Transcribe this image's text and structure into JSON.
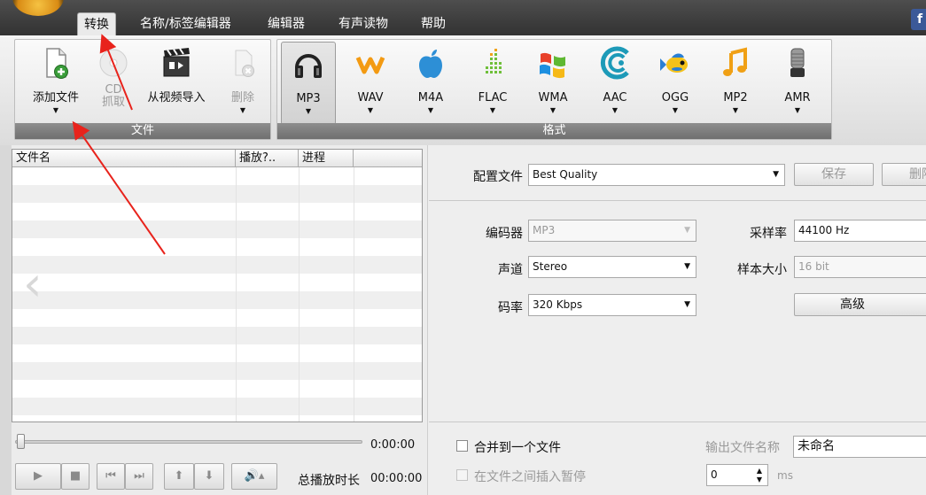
{
  "menu": {
    "tabs": [
      {
        "label": "转换",
        "active": true
      },
      {
        "label": "名称/标签编辑器"
      },
      {
        "label": "编辑器"
      },
      {
        "label": "有声读物"
      },
      {
        "label": "帮助"
      }
    ],
    "facebook_label": "f"
  },
  "ribbon": {
    "file_group": {
      "caption": "文件",
      "buttons": [
        {
          "label": "添加文件",
          "icon": "add-file-icon"
        },
        {
          "label": "CD\n抓取",
          "icon": "cd-icon",
          "disabled": true
        },
        {
          "label": "从视频导入",
          "icon": "clapperboard-icon"
        },
        {
          "label": "删除",
          "icon": "delete-file-icon",
          "disabled": true
        }
      ]
    },
    "format_group": {
      "caption": "格式",
      "formats": [
        {
          "label": "MP3",
          "icon": "headphones-icon",
          "selected": true
        },
        {
          "label": "WAV",
          "icon": "wav-wave-icon"
        },
        {
          "label": "M4A",
          "icon": "apple-icon"
        },
        {
          "label": "FLAC",
          "icon": "flac-bars-icon"
        },
        {
          "label": "WMA",
          "icon": "windows-flag-icon"
        },
        {
          "label": "AAC",
          "icon": "aac-swirl-icon"
        },
        {
          "label": "OGG",
          "icon": "fish-icon"
        },
        {
          "label": "MP2",
          "icon": "music-note-icon"
        },
        {
          "label": "AMR",
          "icon": "microphone-icon"
        }
      ]
    }
  },
  "file_list": {
    "columns": [
      "文件名",
      "播放?..",
      "进程"
    ],
    "rows": []
  },
  "player": {
    "position_time": "0:00:00",
    "total_label": "总播放时长",
    "total_time": "00:00:00"
  },
  "settings": {
    "profile_label": "配置文件",
    "profile_value": "Best Quality",
    "save_label": "保存",
    "delete_label": "删除",
    "codec_label": "编码器",
    "codec_value": "MP3",
    "samplerate_label": "采样率",
    "samplerate_value": "44100 Hz",
    "channel_label": "声道",
    "channel_value": "Stereo",
    "samplesize_label": "样本大小",
    "samplesize_value": "16 bit",
    "bitrate_label": "码率",
    "bitrate_value": "320 Kbps",
    "advanced_label": "高级"
  },
  "output": {
    "merge_label": "合并到一个文件",
    "pause_label": "在文件之间插入暂停",
    "filename_label": "输出文件名称",
    "filename_value": "未命名",
    "pause_value": "0",
    "pause_unit": "ms"
  }
}
